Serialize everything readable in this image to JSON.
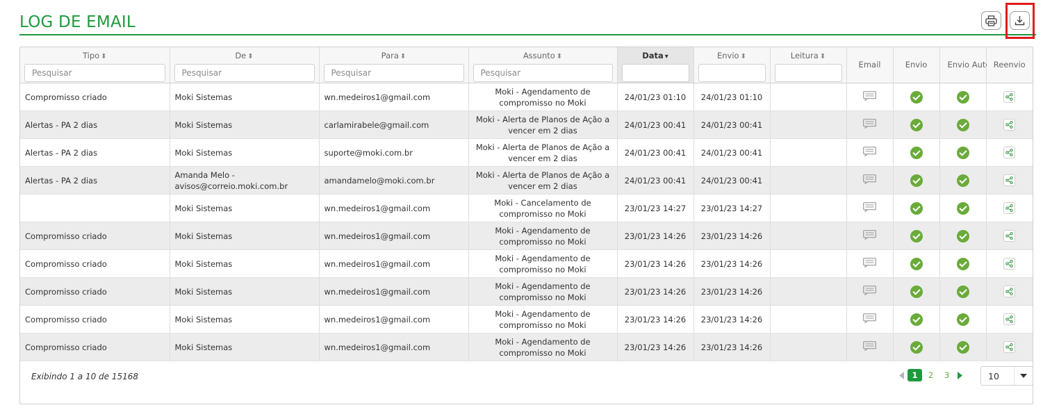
{
  "page_title": "LOG DE EMAIL",
  "toolbar": {
    "print_icon": "printer-icon",
    "download_icon": "download-icon"
  },
  "columns": {
    "tipo": "Tipo",
    "de": "De",
    "para": "Para",
    "assunto": "Assunto",
    "data": "Data",
    "envio": "Envio",
    "leitura": "Leitura",
    "email": "Email",
    "envio_status": "Envio",
    "envio_autom": "Envio Autom.",
    "reenvio": "Reenvio"
  },
  "filters": {
    "placeholder": "Pesquisar"
  },
  "sorted_column": "Data",
  "rows": [
    {
      "tipo": "Compromisso criado",
      "de": "Moki Sistemas",
      "para": "wn.medeiros1@gmail.com",
      "assunto": "Moki - Agendamento de compromisso no Moki",
      "data": "24/01/23 01:10",
      "envio": "24/01/23 01:10",
      "leitura": ""
    },
    {
      "tipo": "Alertas - PA 2 dias",
      "de": "Moki Sistemas",
      "para": "carlamirabele@gmail.com",
      "assunto": "Moki - Alerta de Planos de Ação a vencer em 2 dias",
      "data": "24/01/23 00:41",
      "envio": "24/01/23 00:41",
      "leitura": ""
    },
    {
      "tipo": "Alertas - PA 2 dias",
      "de": "Moki Sistemas",
      "para": "suporte@moki.com.br",
      "assunto": "Moki - Alerta de Planos de Ação a vencer em 2 dias",
      "data": "24/01/23 00:41",
      "envio": "24/01/23 00:41",
      "leitura": ""
    },
    {
      "tipo": "Alertas - PA 2 dias",
      "de": "Amanda Melo - avisos@correio.moki.com.br",
      "para": "amandamelo@moki.com.br",
      "assunto": "Moki - Alerta de Planos de Ação a vencer em 2 dias",
      "data": "24/01/23 00:41",
      "envio": "24/01/23 00:41",
      "leitura": ""
    },
    {
      "tipo": "",
      "de": "Moki Sistemas",
      "para": "wn.medeiros1@gmail.com",
      "assunto": "Moki - Cancelamento de compromisso no Moki",
      "data": "23/01/23 14:27",
      "envio": "23/01/23 14:27",
      "leitura": ""
    },
    {
      "tipo": "Compromisso criado",
      "de": "Moki Sistemas",
      "para": "wn.medeiros1@gmail.com",
      "assunto": "Moki - Agendamento de compromisso no Moki",
      "data": "23/01/23 14:26",
      "envio": "23/01/23 14:26",
      "leitura": ""
    },
    {
      "tipo": "Compromisso criado",
      "de": "Moki Sistemas",
      "para": "wn.medeiros1@gmail.com",
      "assunto": "Moki - Agendamento de compromisso no Moki",
      "data": "23/01/23 14:26",
      "envio": "23/01/23 14:26",
      "leitura": ""
    },
    {
      "tipo": "Compromisso criado",
      "de": "Moki Sistemas",
      "para": "wn.medeiros1@gmail.com",
      "assunto": "Moki - Agendamento de compromisso no Moki",
      "data": "23/01/23 14:26",
      "envio": "23/01/23 14:26",
      "leitura": ""
    },
    {
      "tipo": "Compromisso criado",
      "de": "Moki Sistemas",
      "para": "wn.medeiros1@gmail.com",
      "assunto": "Moki - Agendamento de compromisso no Moki",
      "data": "23/01/23 14:26",
      "envio": "23/01/23 14:26",
      "leitura": ""
    },
    {
      "tipo": "Compromisso criado",
      "de": "Moki Sistemas",
      "para": "wn.medeiros1@gmail.com",
      "assunto": "Moki - Agendamento de compromisso no Moki",
      "data": "23/01/23 14:26",
      "envio": "23/01/23 14:26",
      "leitura": ""
    }
  ],
  "footer": {
    "info": "Exibindo 1 a 10 de 15168",
    "pages": [
      "1",
      "2",
      "3"
    ],
    "current_page": "1",
    "page_size": "10"
  },
  "colors": {
    "accent": "#1e9a3e",
    "success": "#6aab3a",
    "highlight": "#e21b1b",
    "row_alt": "#ececec"
  }
}
